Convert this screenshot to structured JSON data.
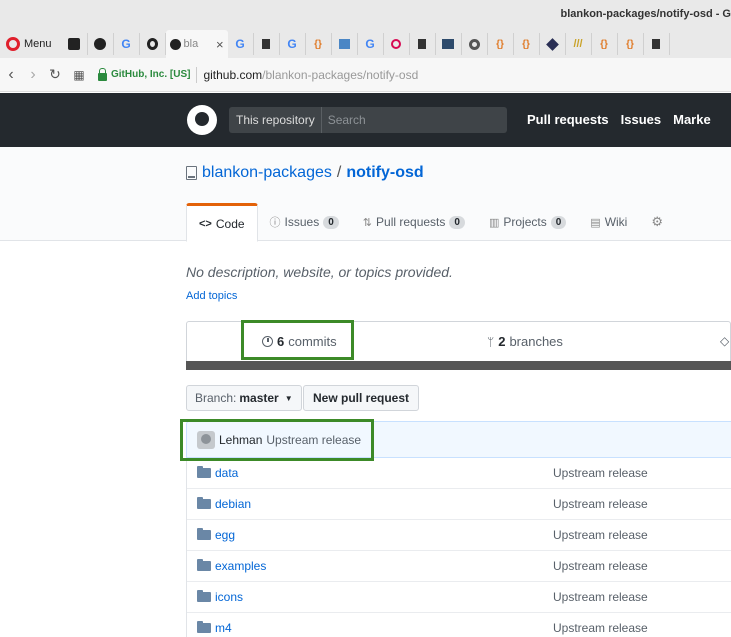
{
  "browser": {
    "window_title": "blankon-packages/notify-osd - G",
    "menu_label": "Menu",
    "active_tab_label": "bla",
    "tab_icons": [
      "trello-icon",
      "github-icon",
      "google-icon",
      "opera-icon"
    ],
    "toolbar_tab_icons": [
      "google-icon",
      "doc-icon",
      "google-icon",
      "brackets-icon",
      "chart-icon",
      "google-icon",
      "debian-icon",
      "doc-icon",
      "image-icon",
      "circle-icon",
      "brackets-icon",
      "brackets-icon",
      "diamond-icon",
      "stripe-icon",
      "brackets-icon",
      "brackets-icon",
      "doc-icon"
    ],
    "secure_label": "GitHub, Inc. [US]",
    "url_domain": "github.com",
    "url_path": "/blankon-packages/notify-osd"
  },
  "github_header": {
    "search_scope": "This repository",
    "search_placeholder": "Search",
    "nav": [
      "Pull requests",
      "Issues",
      "Marke"
    ]
  },
  "repo": {
    "owner": "blankon-packages",
    "separator": "/",
    "name": "notify-osd",
    "tabs": [
      {
        "label": "Code",
        "glyph": "<>",
        "count": ""
      },
      {
        "label": "Issues",
        "glyph": "ⓘ",
        "count": "0"
      },
      {
        "label": "Pull requests",
        "glyph": "⇅",
        "count": "0"
      },
      {
        "label": "Projects",
        "glyph": "▥",
        "count": "0"
      },
      {
        "label": "Wiki",
        "glyph": "▤",
        "count": ""
      }
    ],
    "description": "No description, website, or topics provided.",
    "add_topics": "Add topics",
    "commits_count": "6",
    "commits_label": "commits",
    "branches_count": "2",
    "branches_label": "branches",
    "branch_prefix": "Branch:",
    "branch_name": "master",
    "new_pr_label": "New pull request",
    "latest_commit_author": "Lehman",
    "latest_commit_message": "Upstream release",
    "files": [
      {
        "name": "data",
        "message": "Upstream release"
      },
      {
        "name": "debian",
        "message": "Upstream release"
      },
      {
        "name": "egg",
        "message": "Upstream release"
      },
      {
        "name": "examples",
        "message": "Upstream release"
      },
      {
        "name": "icons",
        "message": "Upstream release"
      },
      {
        "name": "m4",
        "message": "Upstream release"
      }
    ]
  },
  "colors": {
    "github_dark": "#24292e",
    "link_blue": "#0366d6",
    "annotation_green": "#3c8a28",
    "tab_accent": "#e36209"
  }
}
